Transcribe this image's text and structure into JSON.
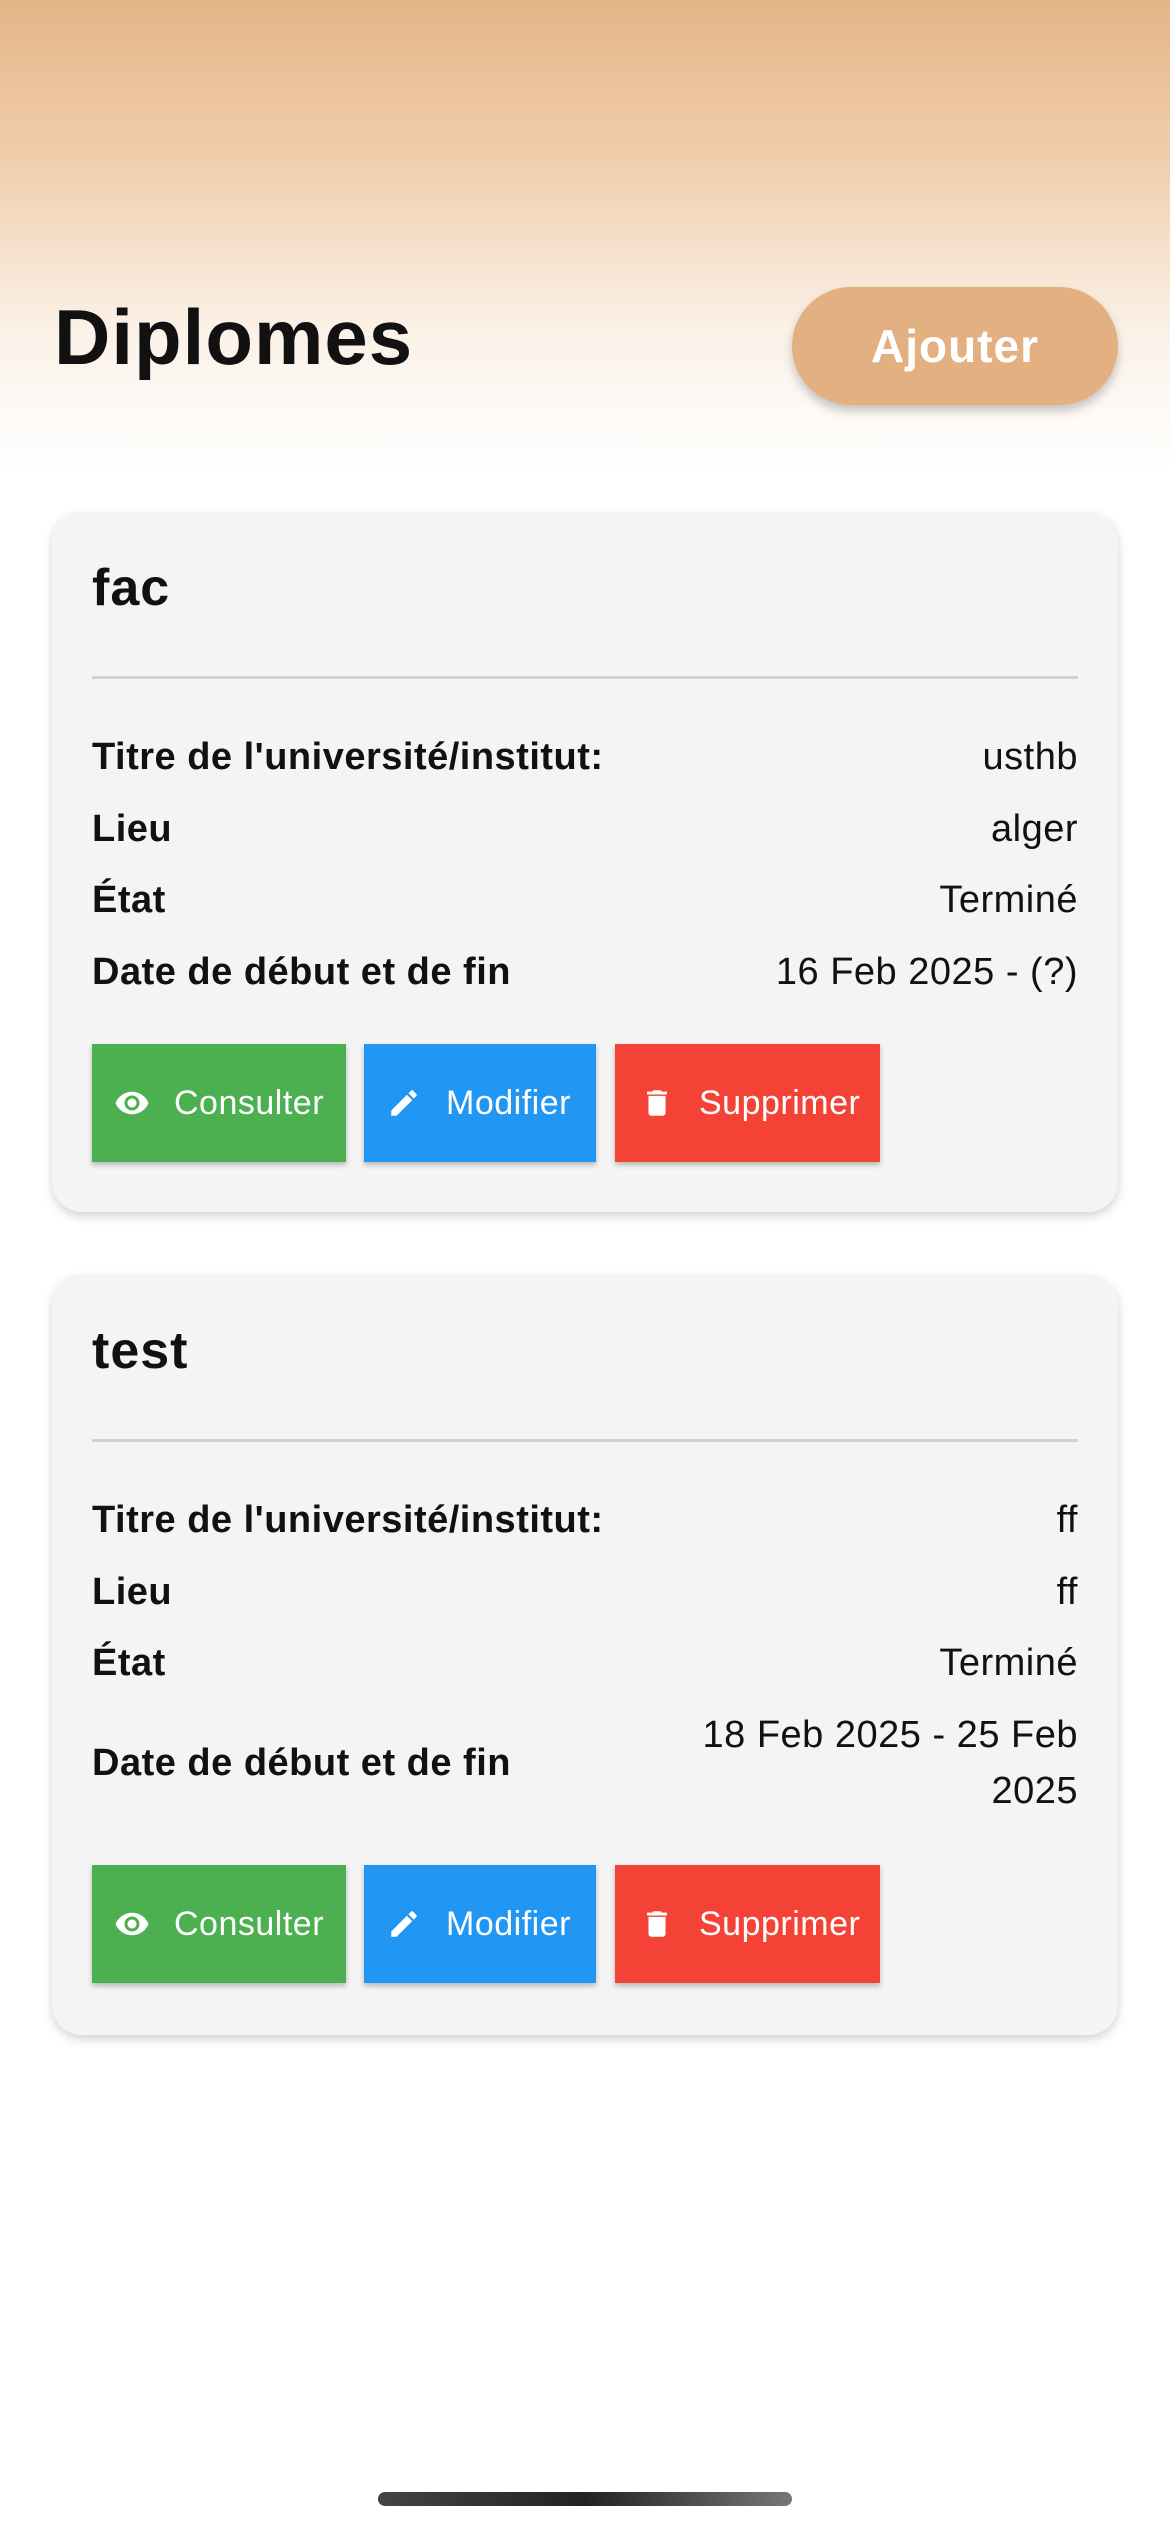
{
  "header": {
    "title": "Diplomes",
    "add_label": "Ajouter",
    "accent_color": "#e3b081"
  },
  "diplomas": [
    {
      "name": "fac",
      "fields": [
        {
          "label": "Titre de l'université/institut:",
          "value": "usthb"
        },
        {
          "label": "Lieu",
          "value": "alger"
        },
        {
          "label": "État",
          "value": "Terminé"
        },
        {
          "label": "Date de début et de fin",
          "value": "16 Feb 2025 - (?)"
        }
      ],
      "actions": {
        "view": "Consulter",
        "edit": "Modifier",
        "delete": "Supprimer"
      }
    },
    {
      "name": "test",
      "fields": [
        {
          "label": "Titre de l'université/institut:",
          "value": "ff"
        },
        {
          "label": "Lieu",
          "value": "ff"
        },
        {
          "label": "État",
          "value": "Terminé"
        },
        {
          "label": "Date de début et de fin",
          "value": "18 Feb 2025 - 25 Feb 2025"
        }
      ],
      "actions": {
        "view": "Consulter",
        "edit": "Modifier",
        "delete": "Supprimer"
      }
    }
  ],
  "icons": {
    "view": "eye-icon",
    "edit": "pencil-icon",
    "delete": "trash-icon"
  },
  "colors": {
    "view": "#4caf50",
    "edit": "#2196f3",
    "delete": "#f44336"
  }
}
